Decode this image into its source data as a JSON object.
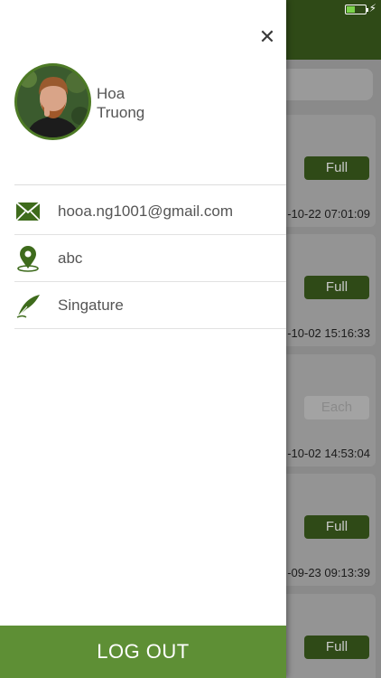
{
  "status_bar": {
    "battery_level": 0.45,
    "charging_icon": "bolt-icon"
  },
  "background_list": {
    "cards": [
      {
        "button": "Full",
        "timestamp": "-10-22 07:01:09",
        "button_disabled": false
      },
      {
        "button": "Full",
        "timestamp": "-10-02 15:16:33",
        "button_disabled": false
      },
      {
        "button": "Each",
        "timestamp": "-10-02 14:53:04",
        "button_disabled": true
      },
      {
        "button": "Full",
        "timestamp": "-09-23 09:13:39",
        "button_disabled": false
      },
      {
        "button": "Full",
        "timestamp": "",
        "button_disabled": false
      }
    ]
  },
  "drawer": {
    "close_icon": "close-icon",
    "profile": {
      "first_name": "Hoa",
      "last_name": "Truong"
    },
    "menu": {
      "email": {
        "label": "hooa.ng1001@gmail.com",
        "icon": "mail-icon"
      },
      "location": {
        "label": "abc",
        "icon": "location-pin-icon"
      },
      "signature": {
        "label": "Singature",
        "icon": "quill-pen-icon"
      }
    },
    "logout_label": "LOG OUT"
  },
  "colors": {
    "accent_green": "#5e8f35",
    "dark_green": "#2f4a17",
    "icon_green": "#4d7a25"
  }
}
